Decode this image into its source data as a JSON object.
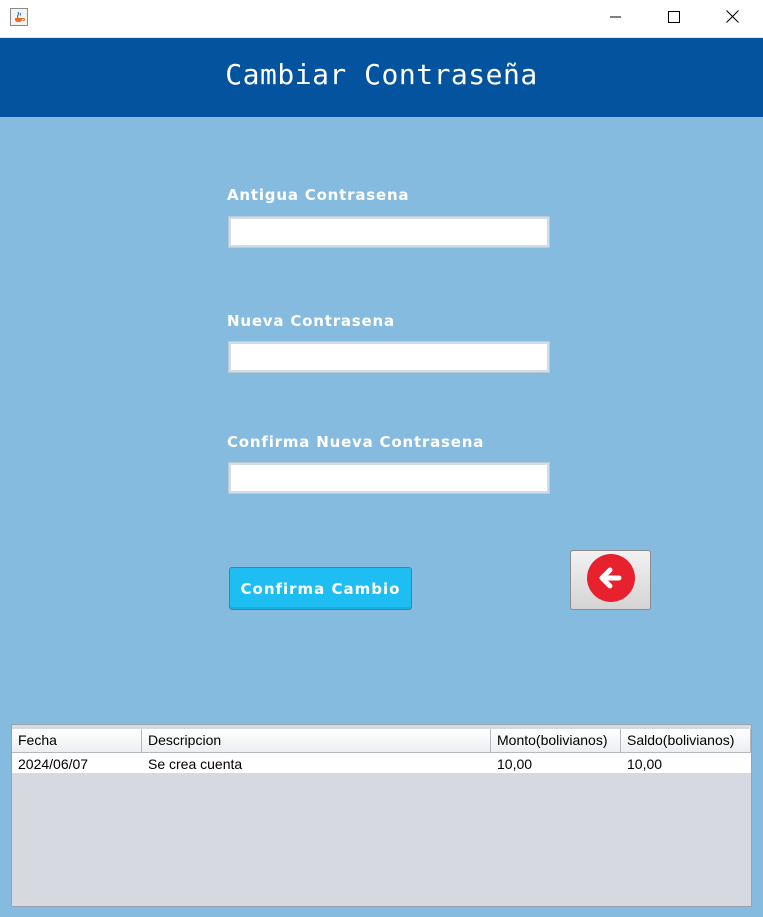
{
  "window": {
    "icon": "java-cup-icon",
    "controls": [
      "minimize-icon",
      "maximize-icon",
      "close-icon"
    ]
  },
  "header": {
    "title": "Cambiar Contraseña",
    "background": "#03539f"
  },
  "form": {
    "old_password_label": "Antigua Contrasena",
    "old_password_value": "",
    "new_password_label": "Nueva Contrasena",
    "new_password_value": "",
    "confirm_password_label": "Confirma Nueva Contrasena",
    "confirm_password_value": "",
    "confirm_button_label": "Confirma Cambio",
    "back_button_icon": "back-arrow-icon"
  },
  "table": {
    "columns": [
      "Fecha",
      "Descripcion",
      "Monto(bolivianos)",
      "Saldo(bolivianos)"
    ],
    "rows": [
      [
        "2024/06/07",
        "Se crea cuenta",
        "10,00",
        "10,00"
      ]
    ]
  },
  "colors": {
    "background": "#86bbe0",
    "header": "#03539f",
    "confirm_button": "#1ebef2",
    "back_icon": "#e8212f"
  }
}
